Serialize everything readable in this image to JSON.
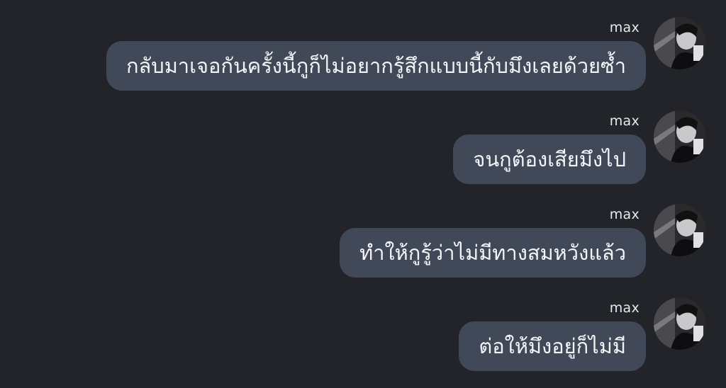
{
  "messages": [
    {
      "sender": "max",
      "text": "กลับมาเจอกันครั้งนี้กูก็ไม่อยากรู้สึกแบบนี้กับมึงเลยด้วยซ้ำ"
    },
    {
      "sender": "max",
      "text": "จนกูต้องเสียมึงไป"
    },
    {
      "sender": "max",
      "text": "ทำให้กูรู้ว่าไม่มีทางสมหวังแล้ว"
    },
    {
      "sender": "max",
      "text": "ต่อให้มึงอยู่ก็ไม่มี"
    }
  ],
  "colors": {
    "background": "#232429",
    "bubble": "#414959",
    "bubble_text": "#f3f4f6",
    "sender_text": "#e8e8ea"
  },
  "icons": {
    "avatar": "profile-photo-avatar"
  }
}
